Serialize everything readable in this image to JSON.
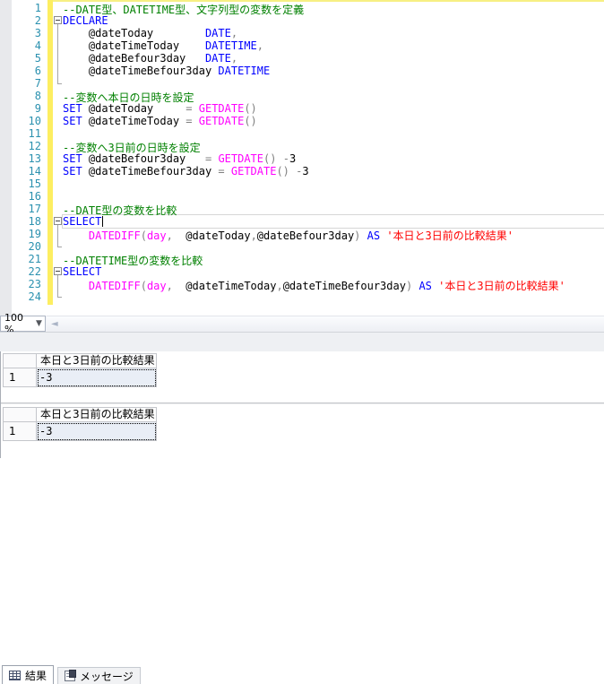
{
  "colors": {
    "comment": "#008000",
    "keyword": "#0000ff",
    "function": "#ff00ff",
    "operator": "#808080",
    "string": "#ff0000",
    "line_number": "#2b91af",
    "change_bar": "#fdee61",
    "selected_cell_bg": "#e9eef6"
  },
  "editor": {
    "caret_line": 18,
    "lines": [
      {
        "n": 1,
        "fold": null,
        "tokens": [
          [
            "cm",
            "--DATE型、DATETIME型、文字列型の変数を定義"
          ]
        ]
      },
      {
        "n": 2,
        "fold": "box",
        "tokens": [
          [
            "kw",
            "DECLARE"
          ]
        ]
      },
      {
        "n": 3,
        "fold": "mid",
        "tokens": [
          [
            "id",
            "    @dateToday        "
          ],
          [
            "kw",
            "DATE"
          ],
          [
            "op",
            ","
          ]
        ]
      },
      {
        "n": 4,
        "fold": "mid",
        "tokens": [
          [
            "id",
            "    @dateTimeToday    "
          ],
          [
            "kw",
            "DATETIME"
          ],
          [
            "op",
            ","
          ]
        ]
      },
      {
        "n": 5,
        "fold": "mid",
        "tokens": [
          [
            "id",
            "    @dateBefour3day   "
          ],
          [
            "kw",
            "DATE"
          ],
          [
            "op",
            ","
          ]
        ]
      },
      {
        "n": 6,
        "fold": "mid",
        "tokens": [
          [
            "id",
            "    @dateTimeBefour3day "
          ],
          [
            "kw",
            "DATETIME"
          ]
        ]
      },
      {
        "n": 7,
        "fold": "end",
        "tokens": []
      },
      {
        "n": 8,
        "fold": null,
        "tokens": [
          [
            "cm",
            "--変数へ本日の日時を設定"
          ]
        ]
      },
      {
        "n": 9,
        "fold": null,
        "tokens": [
          [
            "kw",
            "SET"
          ],
          [
            "id",
            " @dateToday     "
          ],
          [
            "op",
            "="
          ],
          [
            "id",
            " "
          ],
          [
            "fn",
            "GETDATE"
          ],
          [
            "op",
            "()"
          ]
        ]
      },
      {
        "n": 10,
        "fold": null,
        "tokens": [
          [
            "kw",
            "SET"
          ],
          [
            "id",
            " @dateTimeToday "
          ],
          [
            "op",
            "="
          ],
          [
            "id",
            " "
          ],
          [
            "fn",
            "GETDATE"
          ],
          [
            "op",
            "()"
          ]
        ]
      },
      {
        "n": 11,
        "fold": null,
        "tokens": []
      },
      {
        "n": 12,
        "fold": null,
        "tokens": [
          [
            "cm",
            "--変数へ3日前の日時を設定"
          ]
        ]
      },
      {
        "n": 13,
        "fold": null,
        "tokens": [
          [
            "kw",
            "SET"
          ],
          [
            "id",
            " @dateBefour3day   "
          ],
          [
            "op",
            "="
          ],
          [
            "id",
            " "
          ],
          [
            "fn",
            "GETDATE"
          ],
          [
            "op",
            "()"
          ],
          [
            "id",
            " "
          ],
          [
            "op",
            "-"
          ],
          [
            "num",
            "3"
          ]
        ]
      },
      {
        "n": 14,
        "fold": null,
        "tokens": [
          [
            "kw",
            "SET"
          ],
          [
            "id",
            " @dateTimeBefour3day "
          ],
          [
            "op",
            "="
          ],
          [
            "id",
            " "
          ],
          [
            "fn",
            "GETDATE"
          ],
          [
            "op",
            "()"
          ],
          [
            "id",
            " "
          ],
          [
            "op",
            "-"
          ],
          [
            "num",
            "3"
          ]
        ]
      },
      {
        "n": 15,
        "fold": null,
        "tokens": []
      },
      {
        "n": 16,
        "fold": null,
        "tokens": []
      },
      {
        "n": 17,
        "fold": null,
        "tokens": [
          [
            "cm",
            "--DATE型の変数を比較"
          ]
        ]
      },
      {
        "n": 18,
        "fold": "box",
        "current": true,
        "tokens": [
          [
            "kw",
            "SELECT"
          ]
        ]
      },
      {
        "n": 19,
        "fold": "mid",
        "tokens": [
          [
            "id",
            "    "
          ],
          [
            "fn",
            "DATEDIFF"
          ],
          [
            "op",
            "("
          ],
          [
            "fn",
            "day"
          ],
          [
            "op",
            ","
          ],
          [
            "id",
            "  @dateToday"
          ],
          [
            "op",
            ","
          ],
          [
            "id",
            "@dateBefour3day"
          ],
          [
            "op",
            ")"
          ],
          [
            "id",
            " "
          ],
          [
            "kw",
            "AS"
          ],
          [
            "id",
            " "
          ],
          [
            "str",
            "'本日と3日前の比較結果'"
          ]
        ]
      },
      {
        "n": 20,
        "fold": "end",
        "tokens": []
      },
      {
        "n": 21,
        "fold": null,
        "tokens": [
          [
            "cm",
            "--DATETIME型の変数を比較"
          ]
        ]
      },
      {
        "n": 22,
        "fold": "box",
        "tokens": [
          [
            "kw",
            "SELECT"
          ]
        ]
      },
      {
        "n": 23,
        "fold": "mid",
        "tokens": [
          [
            "id",
            "    "
          ],
          [
            "fn",
            "DATEDIFF"
          ],
          [
            "op",
            "("
          ],
          [
            "fn",
            "day"
          ],
          [
            "op",
            ","
          ],
          [
            "id",
            "  @dateTimeToday"
          ],
          [
            "op",
            ","
          ],
          [
            "id",
            "@dateTimeBefour3day"
          ],
          [
            "op",
            ")"
          ],
          [
            "id",
            " "
          ],
          [
            "kw",
            "AS"
          ],
          [
            "id",
            " "
          ],
          [
            "str",
            "'本日と3日前の比較結果'"
          ]
        ]
      },
      {
        "n": 24,
        "fold": "end",
        "tokens": []
      }
    ]
  },
  "statusbar": {
    "zoom_value": "100 %",
    "zoom_dropdown_icon": "chevron-down-icon",
    "scroll_left_icon": "scroll-left-arrow-icon"
  },
  "results": {
    "tabs": [
      {
        "label": "結果",
        "icon": "table-grid-icon",
        "active": true
      },
      {
        "label": "メッセージ",
        "icon": "message-document-icon",
        "active": false
      }
    ],
    "grids": [
      {
        "header": "本日と3日前の比較結果",
        "rows": [
          {
            "num": "1",
            "value": "-3"
          }
        ]
      },
      {
        "header": "本日と3日前の比較結果",
        "rows": [
          {
            "num": "1",
            "value": "-3"
          }
        ]
      }
    ]
  }
}
